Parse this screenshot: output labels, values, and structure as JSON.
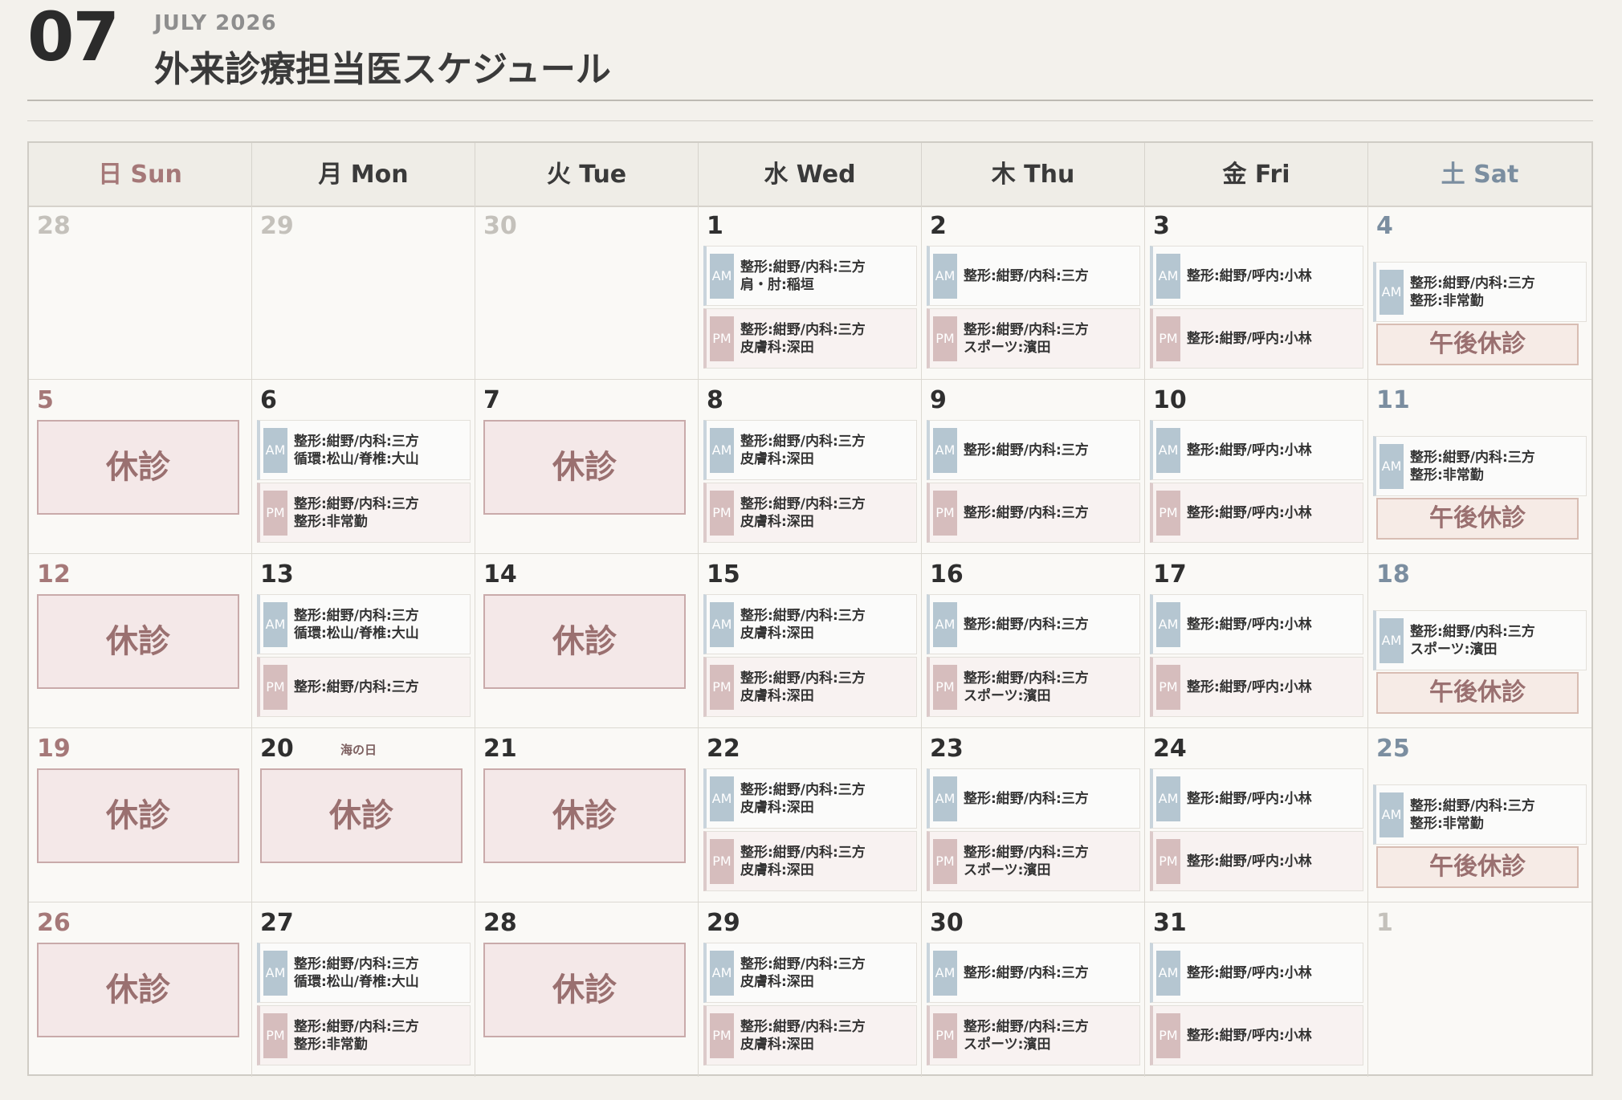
{
  "header": {
    "month_number": "07",
    "month_label": "JULY 2026",
    "title": "外来診療担当医スケジュール"
  },
  "labels": {
    "closed": "休診",
    "pm_closed": "午後休診",
    "am": "AM",
    "pm": "PM"
  },
  "weekdays": [
    "日 Sun",
    "月 Mon",
    "火 Tue",
    "水 Wed",
    "木 Thu",
    "金 Fri",
    "土 Sat"
  ],
  "weeks": [
    [
      {
        "day": "28",
        "outside": true
      },
      {
        "day": "29",
        "outside": true
      },
      {
        "day": "30",
        "outside": true
      },
      {
        "day": "1",
        "am": [
          "整形:紺野/内科:三方",
          "肩・肘:稲垣"
        ],
        "pm": [
          "整形:紺野/内科:三方",
          "皮膚科:深田"
        ]
      },
      {
        "day": "2",
        "am": [
          "整形:紺野/内科:三方"
        ],
        "pm": [
          "整形:紺野/内科:三方",
          "スポーツ:濱田"
        ]
      },
      {
        "day": "3",
        "am": [
          "整形:紺野/呼内:小林"
        ],
        "pm": [
          "整形:紺野/呼内:小林"
        ]
      },
      {
        "day": "4",
        "am": [
          "整形:紺野/内科:三方",
          "整形:非常勤"
        ],
        "pm_closed": true
      }
    ],
    [
      {
        "day": "5",
        "closed": true
      },
      {
        "day": "6",
        "am": [
          "整形:紺野/内科:三方",
          "循環:松山/脊椎:大山"
        ],
        "pm": [
          "整形:紺野/内科:三方",
          "整形:非常勤"
        ]
      },
      {
        "day": "7",
        "closed": true
      },
      {
        "day": "8",
        "am": [
          "整形:紺野/内科:三方",
          "皮膚科:深田"
        ],
        "pm": [
          "整形:紺野/内科:三方",
          "皮膚科:深田"
        ]
      },
      {
        "day": "9",
        "am": [
          "整形:紺野/内科:三方"
        ],
        "pm": [
          "整形:紺野/内科:三方"
        ]
      },
      {
        "day": "10",
        "am": [
          "整形:紺野/呼内:小林"
        ],
        "pm": [
          "整形:紺野/呼内:小林"
        ]
      },
      {
        "day": "11",
        "am": [
          "整形:紺野/内科:三方",
          "整形:非常勤"
        ],
        "pm_closed": true
      }
    ],
    [
      {
        "day": "12",
        "closed": true
      },
      {
        "day": "13",
        "am": [
          "整形:紺野/内科:三方",
          "循環:松山/脊椎:大山"
        ],
        "pm": [
          "整形:紺野/内科:三方"
        ]
      },
      {
        "day": "14",
        "closed": true
      },
      {
        "day": "15",
        "am": [
          "整形:紺野/内科:三方",
          "皮膚科:深田"
        ],
        "pm": [
          "整形:紺野/内科:三方",
          "皮膚科:深田"
        ]
      },
      {
        "day": "16",
        "am": [
          "整形:紺野/内科:三方"
        ],
        "pm": [
          "整形:紺野/内科:三方",
          "スポーツ:濱田"
        ]
      },
      {
        "day": "17",
        "am": [
          "整形:紺野/呼内:小林"
        ],
        "pm": [
          "整形:紺野/呼内:小林"
        ]
      },
      {
        "day": "18",
        "am": [
          "整形:紺野/内科:三方",
          "スポーツ:濱田"
        ],
        "pm_closed": true
      }
    ],
    [
      {
        "day": "19",
        "closed": true
      },
      {
        "day": "20",
        "holiday": "海の日",
        "closed": true
      },
      {
        "day": "21",
        "closed": true
      },
      {
        "day": "22",
        "am": [
          "整形:紺野/内科:三方",
          "皮膚科:深田"
        ],
        "pm": [
          "整形:紺野/内科:三方",
          "皮膚科:深田"
        ]
      },
      {
        "day": "23",
        "am": [
          "整形:紺野/内科:三方"
        ],
        "pm": [
          "整形:紺野/内科:三方",
          "スポーツ:濱田"
        ]
      },
      {
        "day": "24",
        "am": [
          "整形:紺野/呼内:小林"
        ],
        "pm": [
          "整形:紺野/呼内:小林"
        ]
      },
      {
        "day": "25",
        "am": [
          "整形:紺野/内科:三方",
          "整形:非常勤"
        ],
        "pm_closed": true
      }
    ],
    [
      {
        "day": "26",
        "closed": true
      },
      {
        "day": "27",
        "am": [
          "整形:紺野/内科:三方",
          "循環:松山/脊椎:大山"
        ],
        "pm": [
          "整形:紺野/内科:三方",
          "整形:非常勤"
        ]
      },
      {
        "day": "28",
        "closed": true
      },
      {
        "day": "29",
        "am": [
          "整形:紺野/内科:三方",
          "皮膚科:深田"
        ],
        "pm": [
          "整形:紺野/内科:三方",
          "皮膚科:深田"
        ]
      },
      {
        "day": "30",
        "am": [
          "整形:紺野/内科:三方"
        ],
        "pm": [
          "整形:紺野/内科:三方",
          "スポーツ:濱田"
        ]
      },
      {
        "day": "31",
        "am": [
          "整形:紺野/呼内:小林"
        ],
        "pm": [
          "整形:紺野/呼内:小林"
        ]
      },
      {
        "day": "1",
        "outside": true
      }
    ]
  ]
}
